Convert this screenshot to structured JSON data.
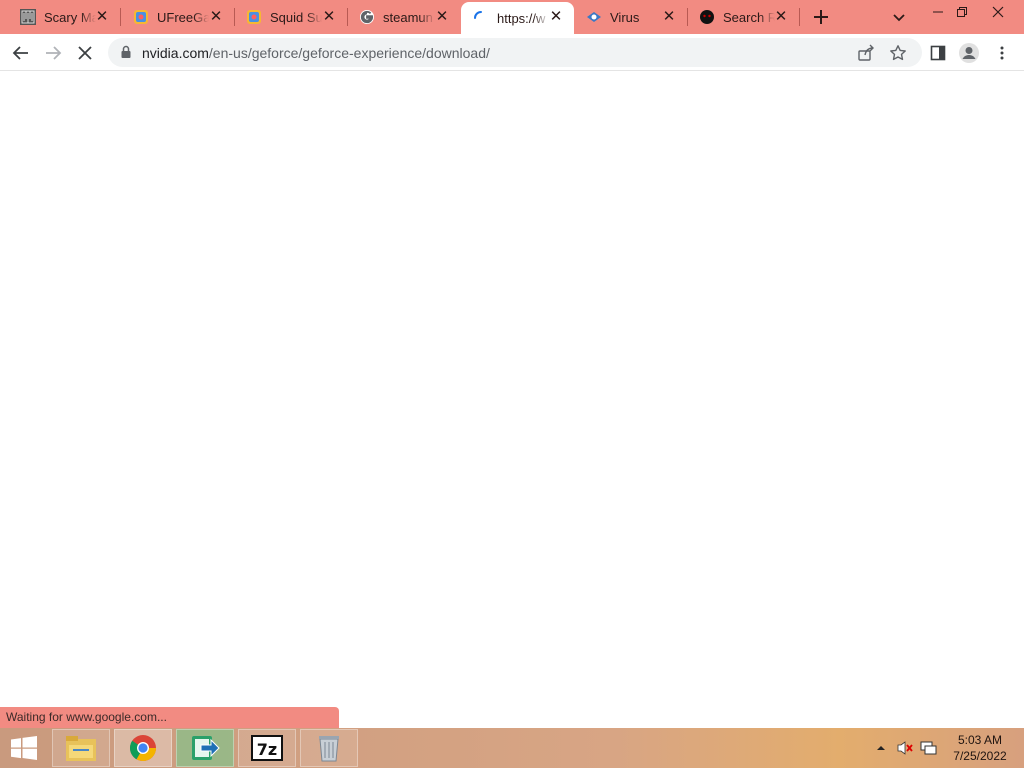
{
  "browser": {
    "tabs": [
      {
        "title": "Scary Maze",
        "icon": "maze-favicon-icon",
        "active": false
      },
      {
        "title": "UFreeGames",
        "icon": "ufreegames-favicon-icon",
        "active": false
      },
      {
        "title": "Squid Sur",
        "icon": "ufreegames-favicon-icon",
        "active": false
      },
      {
        "title": "steamun",
        "icon": "google-favicon-icon",
        "active": false
      },
      {
        "title": "https://w",
        "icon": "loading-spinner-icon",
        "active": true
      },
      {
        "title": "Virus",
        "icon": "virus-favicon-icon",
        "active": false
      },
      {
        "title": "Search R",
        "icon": "dark-face-favicon-icon",
        "active": false
      }
    ],
    "address": {
      "host": "nvidia.com",
      "path": "/en-us/geforce/geforce-experience/download/"
    },
    "status_text": "Waiting for www.google.com...",
    "accent_color": "#f28b82"
  },
  "taskbar": {
    "apps": [
      {
        "name": "File Explorer",
        "icon": "file-explorer-icon"
      },
      {
        "name": "Google Chrome",
        "icon": "chrome-icon"
      },
      {
        "name": "Installer",
        "icon": "installer-arrow-icon"
      },
      {
        "name": "7-Zip",
        "icon": "seven-zip-icon",
        "label": "7z"
      },
      {
        "name": "Recycle Bin",
        "icon": "recycle-bin-icon"
      }
    ],
    "clock": {
      "time": "5:03 AM",
      "date": "7/25/2022"
    }
  }
}
